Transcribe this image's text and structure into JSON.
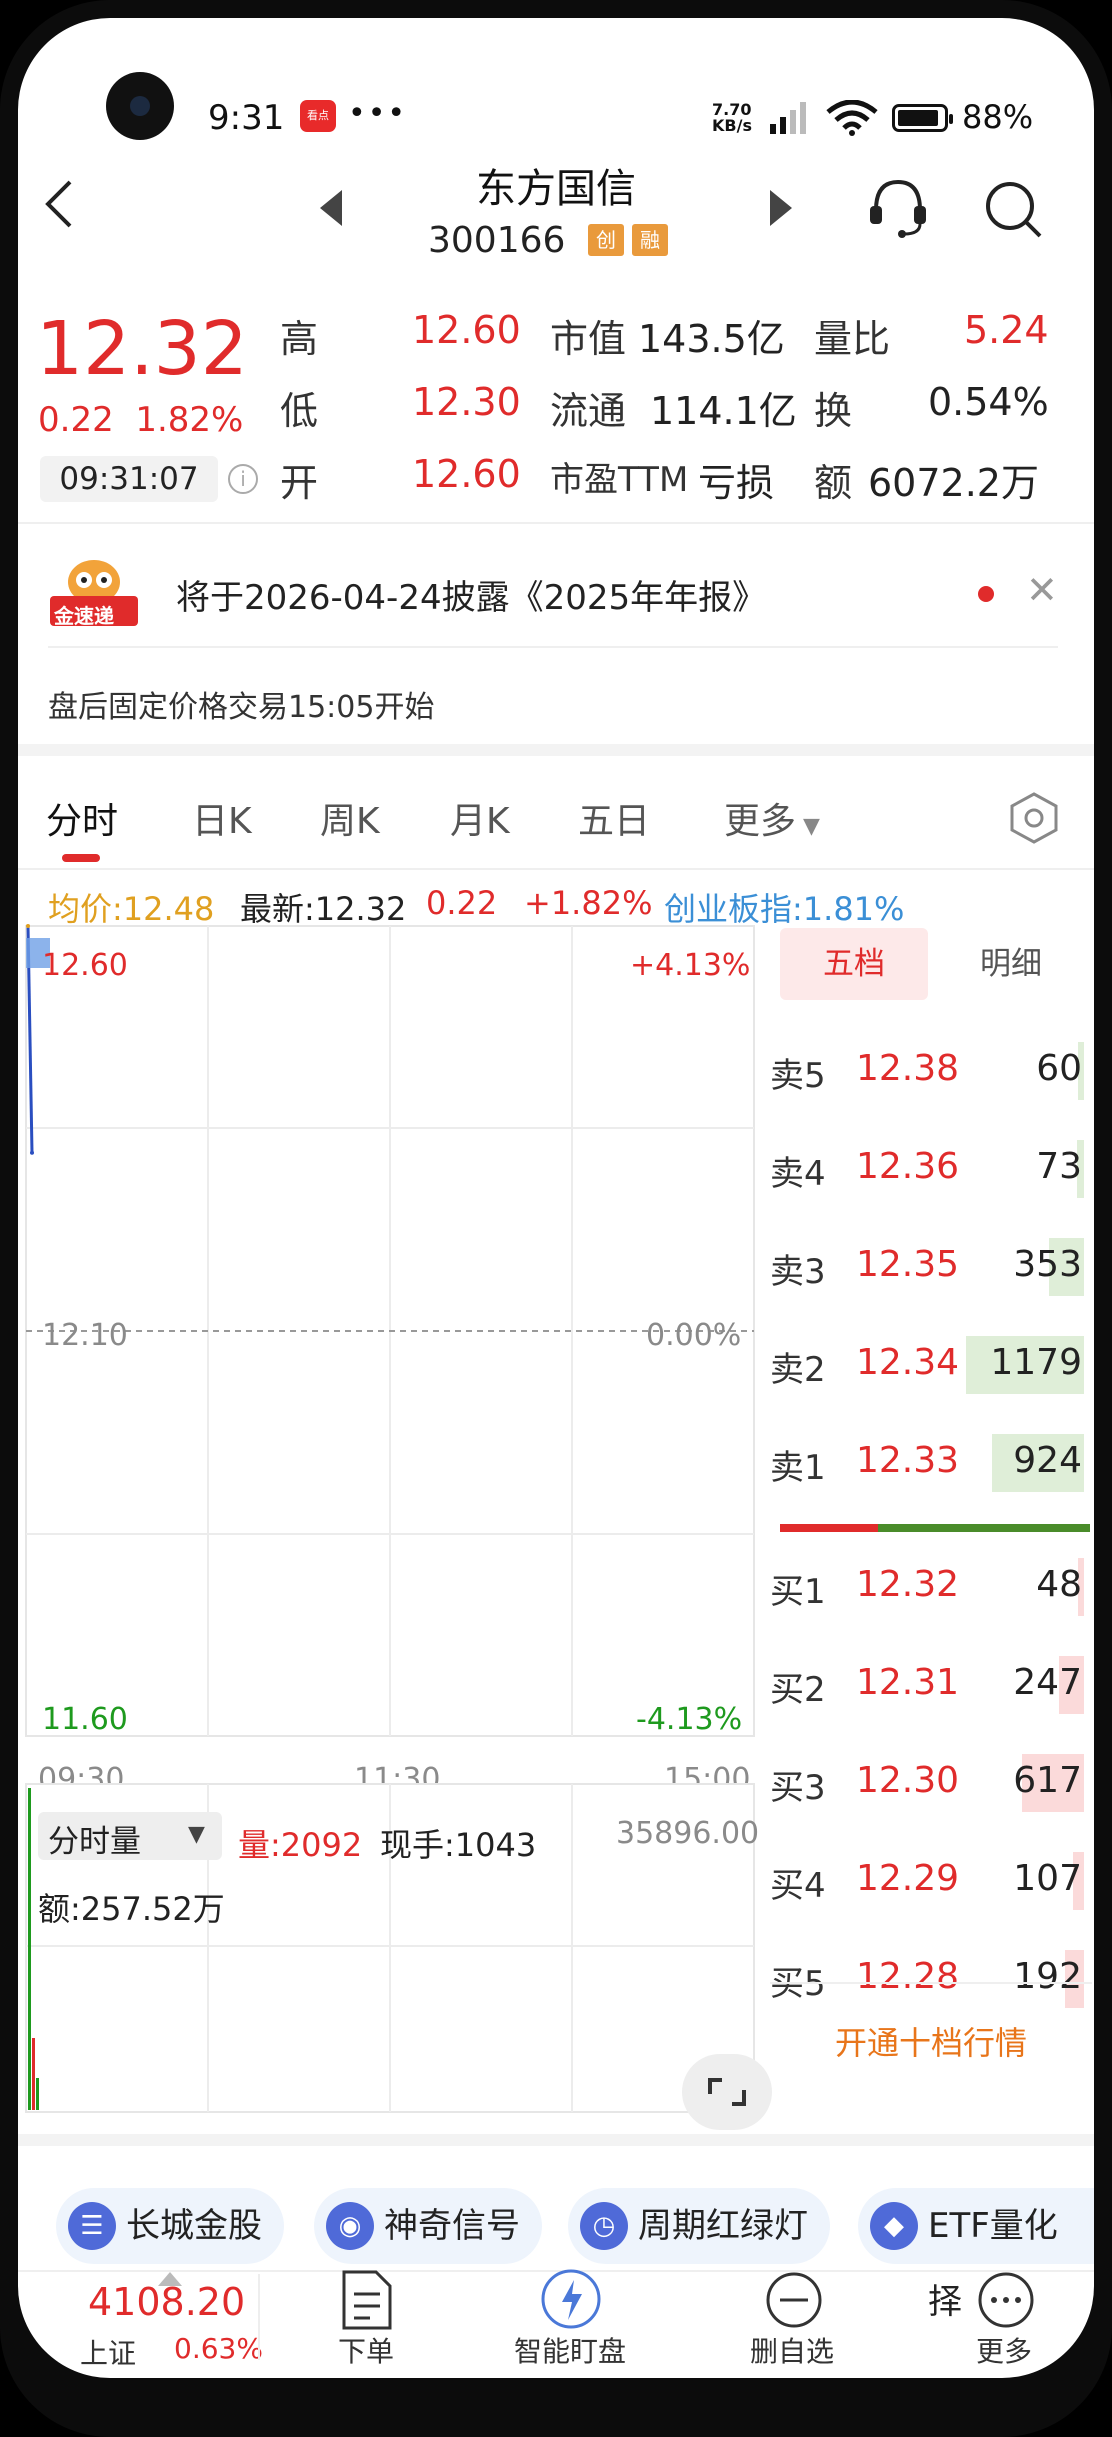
{
  "status_bar": {
    "time": "9:31",
    "app_badge": "看点",
    "more": "•••",
    "net_speed_top": "7.70",
    "net_speed_bottom": "KB/s",
    "battery": "88%"
  },
  "header": {
    "title": "东方国信",
    "code": "300166",
    "tags": [
      "创",
      "融"
    ]
  },
  "quote": {
    "price": "12.32",
    "change": "0.22",
    "change_pct": "1.82%",
    "time": "09:31:07",
    "high_label": "高",
    "high": "12.60",
    "low_label": "低",
    "low": "12.30",
    "open_label": "开",
    "open": "12.60",
    "mcap_label": "市值",
    "mcap": "143.5亿",
    "float_label": "流通",
    "float": "114.1亿",
    "pe_label": "市盈TTM",
    "pe": "亏损",
    "vr_label": "量比",
    "vr": "5.24",
    "turnover_label": "换",
    "turnover": "0.54%",
    "amount_label": "额",
    "amount": "6072.2万"
  },
  "notice": {
    "badge": "金速递",
    "text": "将于2026-04-24披露《2025年年报》",
    "close": "✕"
  },
  "after_hours": "盘后固定价格交易15:05开始",
  "tabs": [
    "分时",
    "日K",
    "周K",
    "月K",
    "五日",
    "更多"
  ],
  "avg_line": {
    "avg": "均价:12.48",
    "latest": "最新:12.32",
    "chg": "0.22",
    "pct": "+1.82%",
    "index": "创业板指:1.81%"
  },
  "chart": {
    "y_top": "12.60",
    "y_mid": "12.10",
    "y_bottom": "11.60",
    "pct_top": "+4.13%",
    "pct_mid": "0.00%",
    "pct_bottom": "-4.13%",
    "x_labels": [
      "09:30",
      "11:30",
      "15:00"
    ]
  },
  "chart_data": {
    "type": "line",
    "x": [
      "09:30",
      "09:31"
    ],
    "series": [
      {
        "values": [
          12.6,
          12.32
        ]
      }
    ],
    "ylim": [
      11.6,
      12.6
    ],
    "reference": 12.1
  },
  "volume": {
    "selector": "分时量",
    "vol": "量:2092",
    "hand": "现手:1043",
    "max": "35896.00",
    "amount": "额:257.52万"
  },
  "orderbook": {
    "tabs": [
      "五档",
      "明细"
    ],
    "asks": [
      {
        "label": "卖5",
        "price": "12.38",
        "vol": "60",
        "size": 60
      },
      {
        "label": "卖4",
        "price": "12.36",
        "vol": "73",
        "size": 73
      },
      {
        "label": "卖3",
        "price": "12.35",
        "vol": "353",
        "size": 353
      },
      {
        "label": "卖2",
        "price": "12.34",
        "vol": "1179",
        "size": 1179
      },
      {
        "label": "卖1",
        "price": "12.33",
        "vol": "924",
        "size": 924
      }
    ],
    "bids": [
      {
        "label": "买1",
        "price": "12.32",
        "vol": "48",
        "size": 48
      },
      {
        "label": "买2",
        "price": "12.31",
        "vol": "247",
        "size": 247
      },
      {
        "label": "买3",
        "price": "12.30",
        "vol": "617",
        "size": 617
      },
      {
        "label": "买4",
        "price": "12.29",
        "vol": "107",
        "size": 107
      },
      {
        "label": "买5",
        "price": "12.28",
        "vol": "192",
        "size": 192
      }
    ],
    "ten_level": "开通十档行情"
  },
  "features": [
    "长城金股",
    "神奇信号",
    "周期红绿灯",
    "ETF量化择"
  ],
  "bottom_nav": {
    "index_value": "4108.20",
    "index_name": "上证",
    "index_pct": "0.63%",
    "items": [
      "下单",
      "智能盯盘",
      "删自选",
      "更多"
    ]
  },
  "colors": {
    "up": "#e02b2b",
    "down": "#1e9a1e",
    "accent": "#3b8fd6",
    "avg": "#e0a020",
    "orange": "#e8751a"
  }
}
